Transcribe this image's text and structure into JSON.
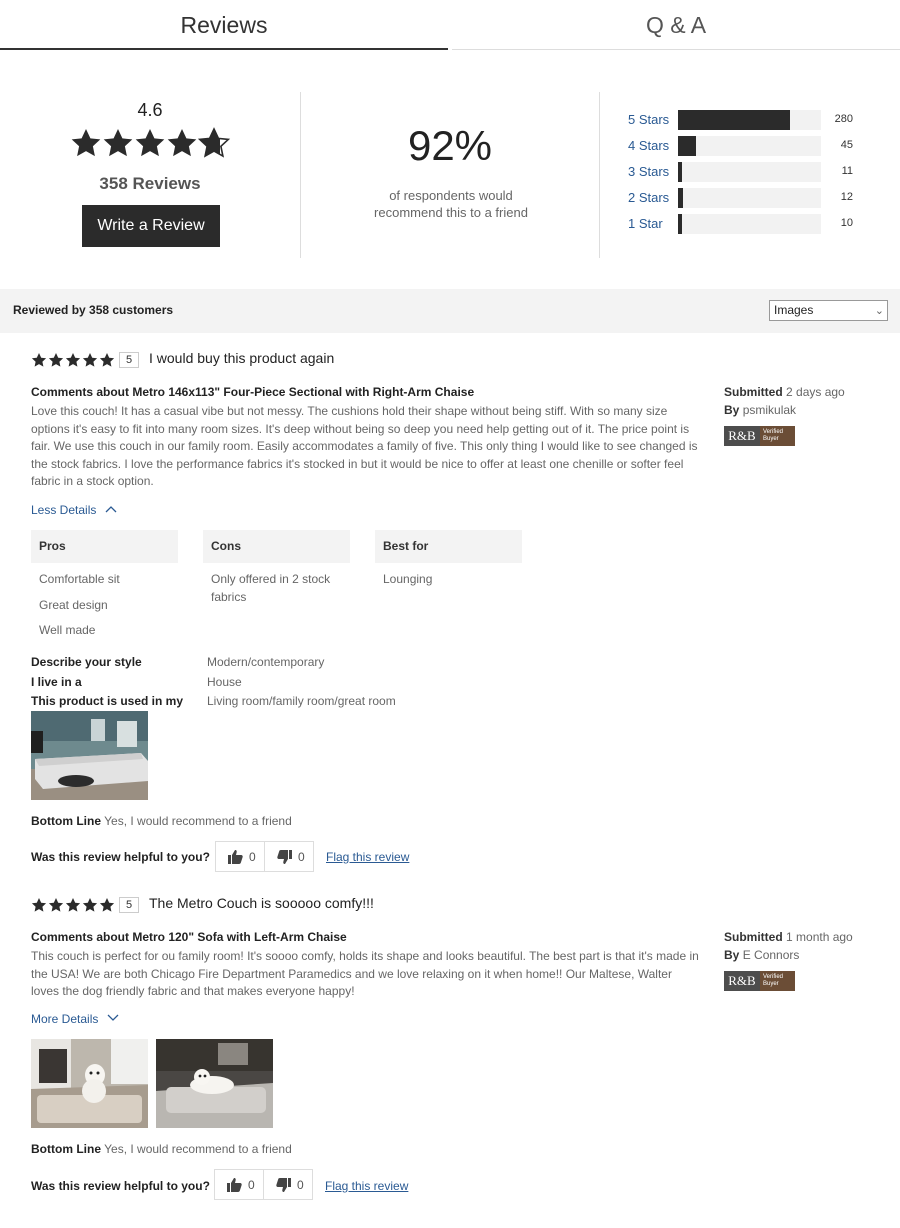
{
  "tabs": {
    "reviews": "Reviews",
    "qa": "Q & A"
  },
  "summary": {
    "average": "4.6",
    "average_rating": 4.6,
    "review_count": "358 Reviews",
    "write_review": "Write a Review",
    "recommend_pct": "92%",
    "recommend_text": "of respondents would recommend this to a friend",
    "distribution": [
      {
        "label": "5 Stars",
        "count": "280",
        "value": 280
      },
      {
        "label": "4 Stars",
        "count": "45",
        "value": 45
      },
      {
        "label": "3 Stars",
        "count": "11",
        "value": 11
      },
      {
        "label": "2 Stars",
        "count": "12",
        "value": 12
      },
      {
        "label": "1 Star",
        "count": "10",
        "value": 10
      }
    ],
    "distribution_max": 358
  },
  "filterbar": {
    "reviewed_by": "Reviewed by 358 customers",
    "sort_value": "Images"
  },
  "reviews": [
    {
      "rating": "5",
      "title": "I would buy this product again",
      "comments": "Comments about Metro 146x113\" Four-Piece Sectional with Right-Arm Chaise",
      "body": "Love this couch! It has a casual vibe but not messy. The cushions hold their shape without being stiff. With so many size options it's easy to fit into many room sizes. It's deep without being so deep you need help getting out of it. The price point is fair. We use this couch in our family room. Easily accommodates a family of five. This only thing I would like to see changed is the stock fabrics. I love the performance fabrics it's stocked in but it would be nice to offer at least one chenille or softer feel fabric in a stock option.",
      "submitted_label": "Submitted",
      "submitted_value": "2 days ago",
      "by_label": "By",
      "by_value": "psmikulak",
      "badge_logo": "R&B",
      "badge_text": "Verified Buyer",
      "details_toggle": "Less Details",
      "pros_label": "Pros",
      "pros": [
        "Comfortable sit",
        "Great design",
        "Well made"
      ],
      "cons_label": "Cons",
      "cons": [
        "Only offered in 2 stock fabrics"
      ],
      "bestfor_label": "Best for",
      "bestfor": [
        "Lounging"
      ],
      "attributes": [
        {
          "key": "Describe your style",
          "value": "Modern/contemporary"
        },
        {
          "key": "I live in a",
          "value": "House"
        },
        {
          "key": "This product is used in my",
          "value": "Living room/family room/great room"
        }
      ],
      "bottom_line_label": "Bottom Line",
      "bottom_line": "Yes, I would recommend to a friend",
      "helpful_q": "Was this review helpful to you?",
      "upvotes": "0",
      "downvotes": "0",
      "flag": "Flag this review"
    },
    {
      "rating": "5",
      "title": "The Metro Couch is sooooo comfy!!!",
      "comments": "Comments about Metro 120\" Sofa with Left-Arm Chaise",
      "body": "This couch is perfect for ou family room! It's soooo comfy, holds its shape and looks beautiful. The best part is that it's made in the USA! We are both Chicago Fire Department Paramedics and we love relaxing on it when home!! Our Maltese, Walter loves the dog friendly fabric and that makes everyone happy!",
      "submitted_label": "Submitted",
      "submitted_value": "1 month ago",
      "by_label": "By",
      "by_value": "E Connors",
      "badge_logo": "R&B",
      "badge_text": "Verified Buyer",
      "details_toggle": "More Details",
      "bottom_line_label": "Bottom Line",
      "bottom_line": "Yes, I would recommend to a friend",
      "helpful_q": "Was this review helpful to you?",
      "upvotes": "0",
      "downvotes": "0",
      "flag": "Flag this review"
    }
  ],
  "icons": {
    "star": "star-icon",
    "half_star": "half-star-icon",
    "chevron_up": "chevron-up-icon",
    "chevron_down": "chevron-down-icon",
    "thumbs_up": "thumbs-up-icon",
    "thumbs_down": "thumbs-down-icon"
  },
  "colors": {
    "link": "#2a5a93",
    "dark": "#2b2b2b",
    "badge_brown": "#6b4d36"
  }
}
